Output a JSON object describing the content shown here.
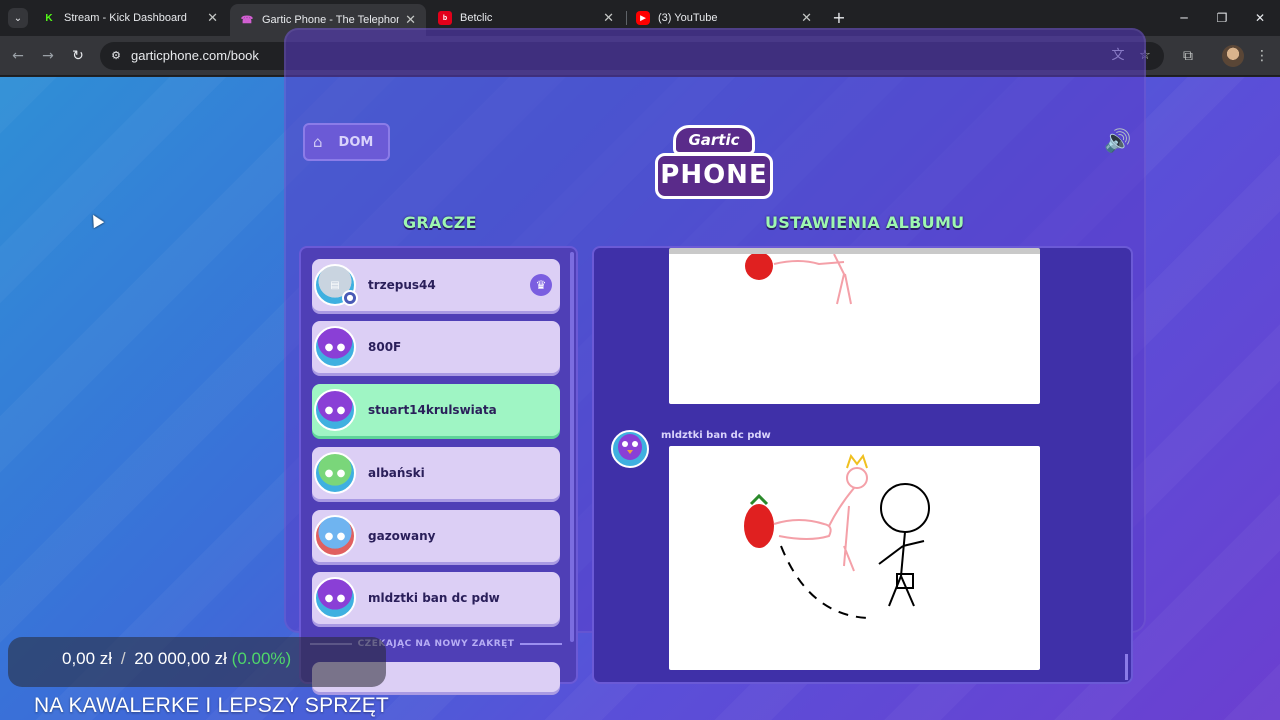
{
  "browser": {
    "tabs": [
      {
        "title": "Stream - Kick Dashboard",
        "icon": "kick-icon"
      },
      {
        "title": "Gartic Phone - The Telephone G",
        "icon": "gartic-icon",
        "active": true
      },
      {
        "title": "Betclic",
        "icon": "betclic-icon"
      },
      {
        "title": "(3) YouTube",
        "icon": "youtube-icon"
      }
    ],
    "url": "garticphone.com/book"
  },
  "game": {
    "home_label": "DOM",
    "logo_top": "Gartic",
    "logo_bottom": "PHONE",
    "players_title": "GRACZE",
    "album_title": "USTAWIENIA ALBUMU",
    "players": [
      {
        "name": "trzepus44",
        "avatar": "knight",
        "host": true
      },
      {
        "name": "800F",
        "avatar": "bird"
      },
      {
        "name": "stuart14krulswiata",
        "avatar": "bird",
        "highlighted": true
      },
      {
        "name": "albański",
        "avatar": "croc"
      },
      {
        "name": "gazowany",
        "avatar": "king"
      },
      {
        "name": "mldztki ban dc pdw",
        "avatar": "bird"
      }
    ],
    "waiting_label": "CZEKAJĄC NA NOWY ZAKRĘT",
    "album": {
      "author": "mldztki ban dc pdw"
    }
  },
  "overlay": {
    "current": "0,00 zł",
    "separator": "/",
    "target": "20 000,00 zł",
    "percent": "(0.00%)",
    "goal_title": "NA KAWALERKE I LEPSZY SPRZĘT"
  }
}
